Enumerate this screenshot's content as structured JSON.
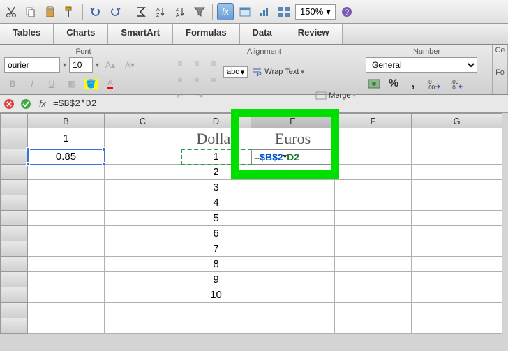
{
  "toolbar": {
    "zoom": "150%"
  },
  "tabs": [
    "Tables",
    "Charts",
    "SmartArt",
    "Formulas",
    "Data",
    "Review"
  ],
  "ribbon": {
    "font": {
      "label": "Font",
      "name": "ourier",
      "size": "10"
    },
    "alignment": {
      "label": "Alignment",
      "abc": "abc",
      "wrap": "Wrap Text",
      "merge": "Merge"
    },
    "number": {
      "label": "Number",
      "format": "General",
      "percent": "%",
      "comma": ",",
      "inc_dec": ".0",
      "dec_dec": ".00"
    },
    "cells_short": "Ce",
    "format_short": "Fo"
  },
  "formula_bar": {
    "fx": "fx",
    "formula": "=$B$2*D2"
  },
  "columns": [
    "B",
    "C",
    "D",
    "E",
    "F",
    "G"
  ],
  "headers": {
    "D": "Dollar",
    "E": "Euros"
  },
  "cells": {
    "B1": "1",
    "B2": "0.85",
    "D2": "1",
    "D3": "2",
    "D4": "3",
    "D5": "4",
    "D6": "5",
    "D7": "6",
    "D8": "7",
    "D9": "8",
    "D10": "9",
    "D11": "10"
  },
  "editing": {
    "eq": "=",
    "ref1": "$B$2",
    "op": "*",
    "ref2": "D2"
  },
  "colors": {
    "highlight_green": "#00e000",
    "select_blue": "#3b73d1",
    "select_green": "#2a9d3f"
  }
}
